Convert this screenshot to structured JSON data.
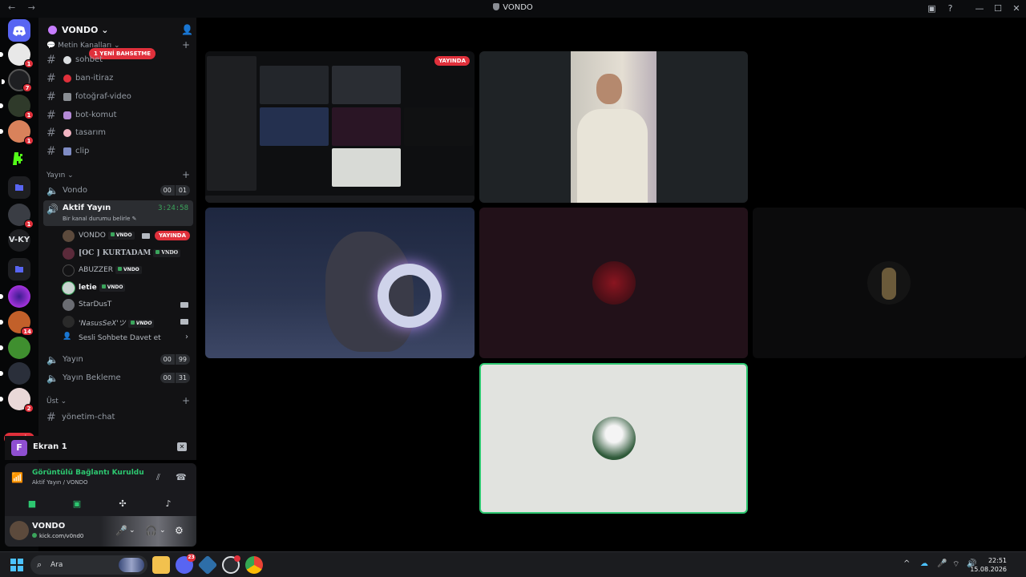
{
  "window": {
    "title": "VONDO",
    "back": "←",
    "forward": "→"
  },
  "guilds": {
    "badges": [
      "1",
      "7",
      "1",
      "1",
      "1",
      "14",
      "2"
    ],
    "server_label": "V-KY",
    "new_label": "YENİ"
  },
  "server": {
    "name": "VONDO"
  },
  "text_category": "Metin Kanalları",
  "mention_pill": "1 YENİ BAHSETME",
  "text_channels": [
    {
      "name": "sohbet"
    },
    {
      "name": "ban-itiraz"
    },
    {
      "name": "fotoğraf-video"
    },
    {
      "name": "bot-komut"
    },
    {
      "name": "tasarım"
    },
    {
      "name": "clip"
    }
  ],
  "voice_category": "Yayın",
  "voice_channels": [
    {
      "name": "Vondo",
      "count_a": "00",
      "count_b": "01"
    }
  ],
  "active_channel": {
    "name": "Aktif Yayın",
    "timer": "3:24:58",
    "status": "Bir kanal durumu belirle"
  },
  "voice_users": [
    {
      "name": "VONDO",
      "tag": "VNDO",
      "live": "YAYINDA"
    },
    {
      "name": "[OC ] KURTADAM",
      "tag": "VNDO"
    },
    {
      "name": "ABUZZER",
      "tag": "VNDO"
    },
    {
      "name": "letie",
      "tag": "VNDO"
    },
    {
      "name": "StarDusT",
      "tag": ""
    },
    {
      "name": "'NasusSeX'ツ",
      "tag": "VNDO"
    }
  ],
  "invite_to_voice": "Sesli Sohbete Davet et",
  "more_voice_channels": [
    {
      "name": "Yayın",
      "count_a": "00",
      "count_b": "99"
    },
    {
      "name": "Yayın Bekleme",
      "count_a": "00",
      "count_b": "31"
    }
  ],
  "upper_category": "Üst",
  "upper_channels": [
    {
      "name": "yönetim-chat"
    }
  ],
  "screen_share": {
    "label": "Ekran 1",
    "favicon": "F"
  },
  "connection": {
    "status": "Görüntülü Bağlantı Kuruldu",
    "location": "Aktif Yayın / VONDO"
  },
  "user": {
    "name": "VONDO",
    "status": "kick.com/v0nd0"
  },
  "stage": {
    "live_label": "YAYINDA"
  },
  "taskbar": {
    "search_placeholder": "Ara",
    "discord_badge": "23",
    "time": "22:51",
    "date": "15.08.2026"
  },
  "colors": {
    "accent_red": "#e0303b",
    "speaking_green": "#3ba55c",
    "connected_green": "#2dc770",
    "sidebar": "#121214"
  }
}
